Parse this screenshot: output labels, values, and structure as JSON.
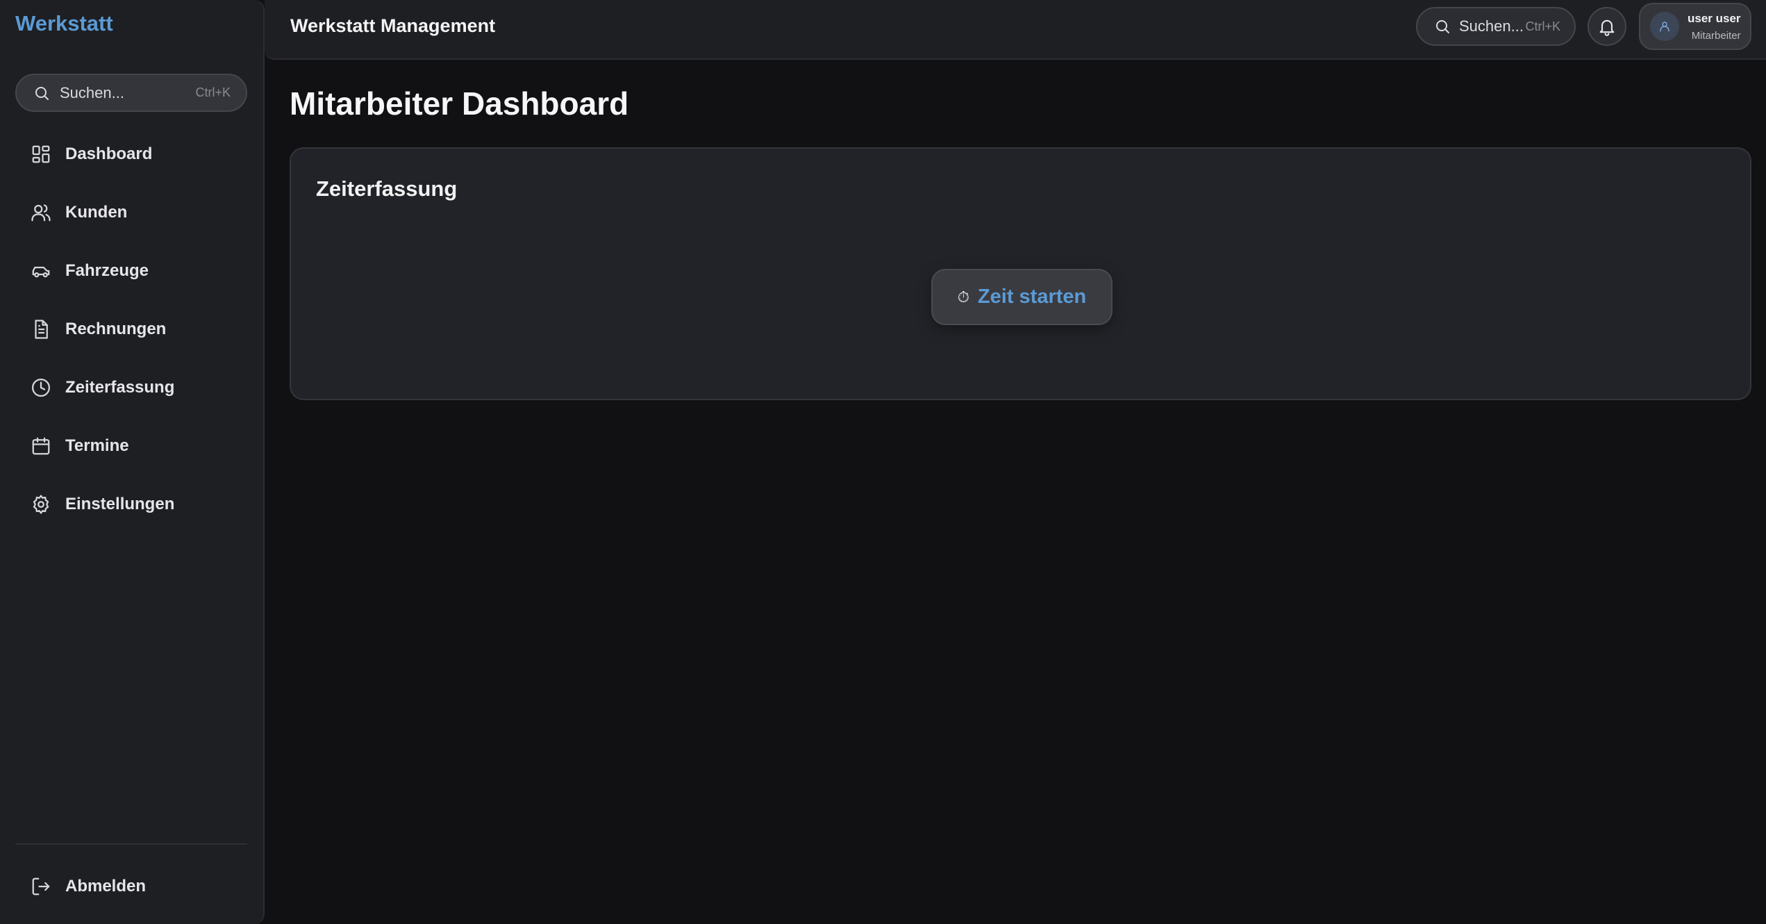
{
  "sidebar": {
    "brand": "Werkstatt",
    "search": {
      "placeholder": "Suchen...",
      "shortcut": "Ctrl+K"
    },
    "items": [
      {
        "label": "Dashboard",
        "icon": "dashboard-grid-icon"
      },
      {
        "label": "Kunden",
        "icon": "users-icon"
      },
      {
        "label": "Fahrzeuge",
        "icon": "car-icon"
      },
      {
        "label": "Rechnungen",
        "icon": "document-icon"
      },
      {
        "label": "Zeiterfassung",
        "icon": "clock-icon"
      },
      {
        "label": "Termine",
        "icon": "calendar-icon"
      },
      {
        "label": "Einstellungen",
        "icon": "gear-icon"
      }
    ],
    "logout": {
      "label": "Abmelden",
      "icon": "logout-icon"
    }
  },
  "topbar": {
    "title": "Werkstatt Management",
    "search": {
      "placeholder": "Suchen...",
      "shortcut": "Ctrl+K"
    },
    "user": {
      "name": "user user",
      "role": "Mitarbeiter"
    }
  },
  "main": {
    "page_title": "Mitarbeiter Dashboard",
    "card": {
      "title": "Zeiterfassung",
      "start_button": {
        "icon": "⏱",
        "label": "Zeit starten"
      }
    }
  },
  "colors": {
    "accent": "#5b9bd5",
    "background": "#111114",
    "panel": "#1e1f23",
    "card": "#222328"
  }
}
